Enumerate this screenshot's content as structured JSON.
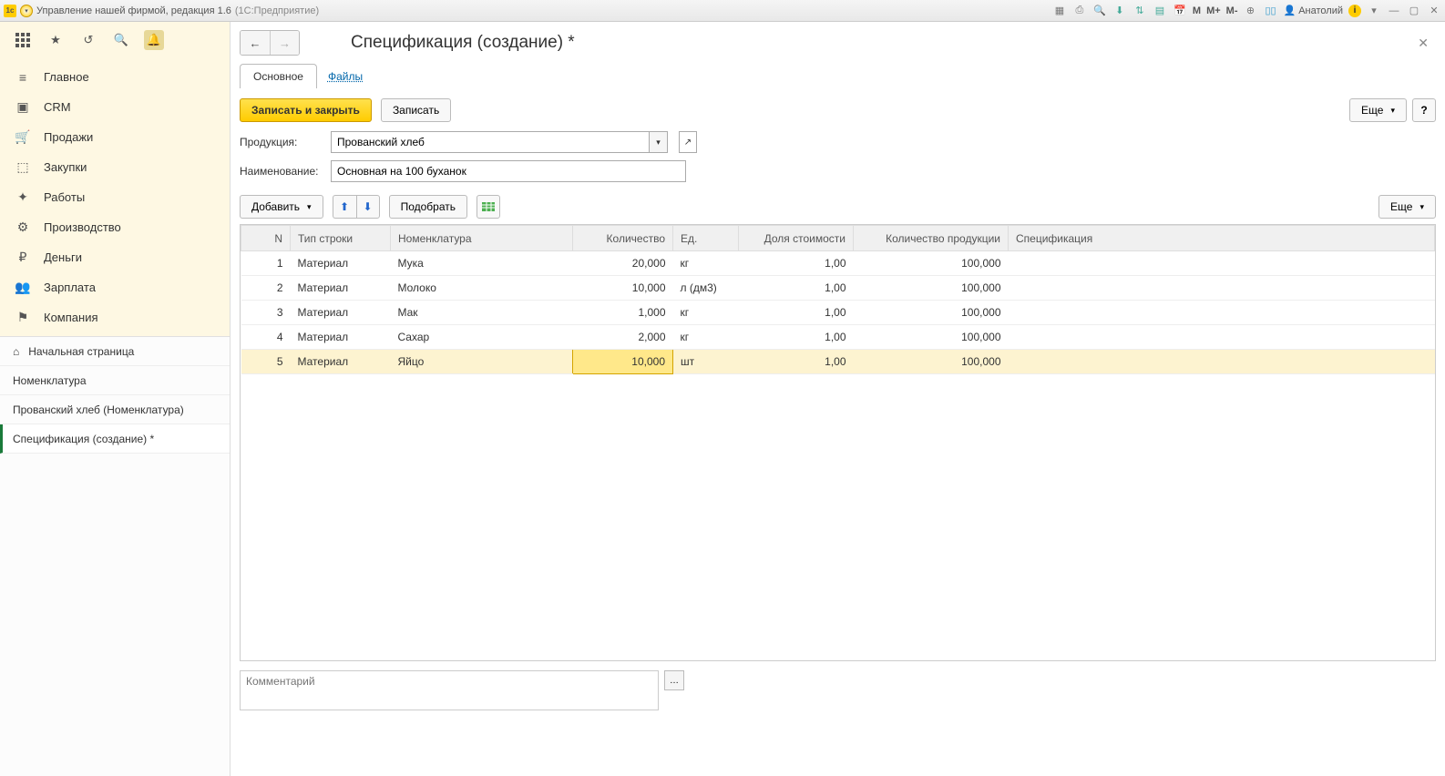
{
  "titlebar": {
    "app_title": "Управление нашей фирмой, редакция 1.6",
    "platform": "(1С:Предприятие)",
    "user": "Анатолий"
  },
  "sidebar": {
    "items": [
      {
        "icon": "menu",
        "label": "Главное"
      },
      {
        "icon": "briefcase",
        "label": "CRM"
      },
      {
        "icon": "cart",
        "label": "Продажи"
      },
      {
        "icon": "box",
        "label": "Закупки"
      },
      {
        "icon": "tools",
        "label": "Работы"
      },
      {
        "icon": "factory",
        "label": "Производство"
      },
      {
        "icon": "coin",
        "label": "Деньги"
      },
      {
        "icon": "people",
        "label": "Зарплата"
      },
      {
        "icon": "flag",
        "label": "Компания"
      }
    ],
    "lower": [
      {
        "icon": "home",
        "label": "Начальная страница",
        "active": false
      },
      {
        "icon": "",
        "label": "Номенклатура",
        "active": false
      },
      {
        "icon": "",
        "label": "Прованский хлеб (Номенклатура)",
        "active": false
      },
      {
        "icon": "",
        "label": "Спецификация (создание) *",
        "active": true
      }
    ]
  },
  "page": {
    "title": "Спецификация (создание) *",
    "tabs": {
      "main": "Основное",
      "files": "Файлы"
    },
    "cmd": {
      "save_close": "Записать и закрыть",
      "save": "Записать",
      "more": "Еще",
      "help": "?"
    },
    "fields": {
      "product_label": "Продукция:",
      "product_value": "Прованский хлеб",
      "name_label": "Наименование:",
      "name_value": "Основная на 100 буханок"
    },
    "table_cmd": {
      "add": "Добавить",
      "pick": "Подобрать",
      "more": "Еще"
    },
    "columns": {
      "n": "N",
      "row_type": "Тип строки",
      "nom": "Номенклатура",
      "qty": "Количество",
      "unit": "Ед.",
      "cost_share": "Доля стоимости",
      "prod_qty": "Количество продукции",
      "spec": "Спецификация"
    },
    "rows": [
      {
        "n": 1,
        "type": "Материал",
        "nom": "Мука",
        "qty": "20,000",
        "unit": "кг",
        "share": "1,00",
        "pqty": "100,000",
        "spec": ""
      },
      {
        "n": 2,
        "type": "Материал",
        "nom": "Молоко",
        "qty": "10,000",
        "unit": "л (дм3)",
        "share": "1,00",
        "pqty": "100,000",
        "spec": ""
      },
      {
        "n": 3,
        "type": "Материал",
        "nom": "Мак",
        "qty": "1,000",
        "unit": "кг",
        "share": "1,00",
        "pqty": "100,000",
        "spec": ""
      },
      {
        "n": 4,
        "type": "Материал",
        "nom": "Сахар",
        "qty": "2,000",
        "unit": "кг",
        "share": "1,00",
        "pqty": "100,000",
        "spec": ""
      },
      {
        "n": 5,
        "type": "Материал",
        "nom": "Яйцо",
        "qty": "10,000",
        "unit": "шт",
        "share": "1,00",
        "pqty": "100,000",
        "spec": "",
        "selected": true,
        "editing": true
      }
    ],
    "comment_placeholder": "Комментарий"
  }
}
